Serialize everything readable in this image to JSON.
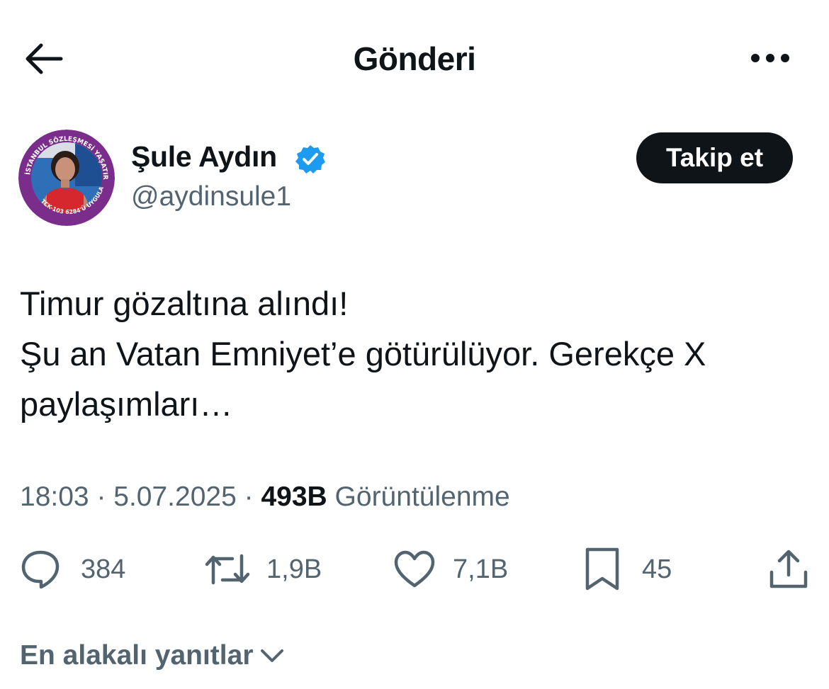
{
  "header": {
    "title": "Gönderi"
  },
  "author": {
    "name": "Şule Aydın",
    "handle": "@aydinsule1",
    "verified": true,
    "follow_label": "Takip et",
    "avatar": {
      "ring_text_top": "İSTANBUL SÖZLEŞMESİ YAŞATIR",
      "ring_text_left": "TCK-103",
      "ring_text_bottom": "6284'Ü UYGULA",
      "ring_color": "#7b2d8b"
    }
  },
  "tweet": {
    "text": "Timur gözaltına alındı!\nŞu an Vatan Emniyet’e götürülüyor. Gerekçe X paylaşımları…",
    "time": "18:03",
    "date": "5.07.2025",
    "views_count": "493B",
    "views_label": "Görüntülenme"
  },
  "actions": {
    "replies": "384",
    "reposts": "1,9B",
    "likes": "7,1B",
    "bookmarks": "45"
  },
  "replies_sort": {
    "label": "En alakalı yanıtlar"
  },
  "colors": {
    "text": "#0f1419",
    "secondary": "#536471",
    "verified": "#1d9bf0"
  }
}
